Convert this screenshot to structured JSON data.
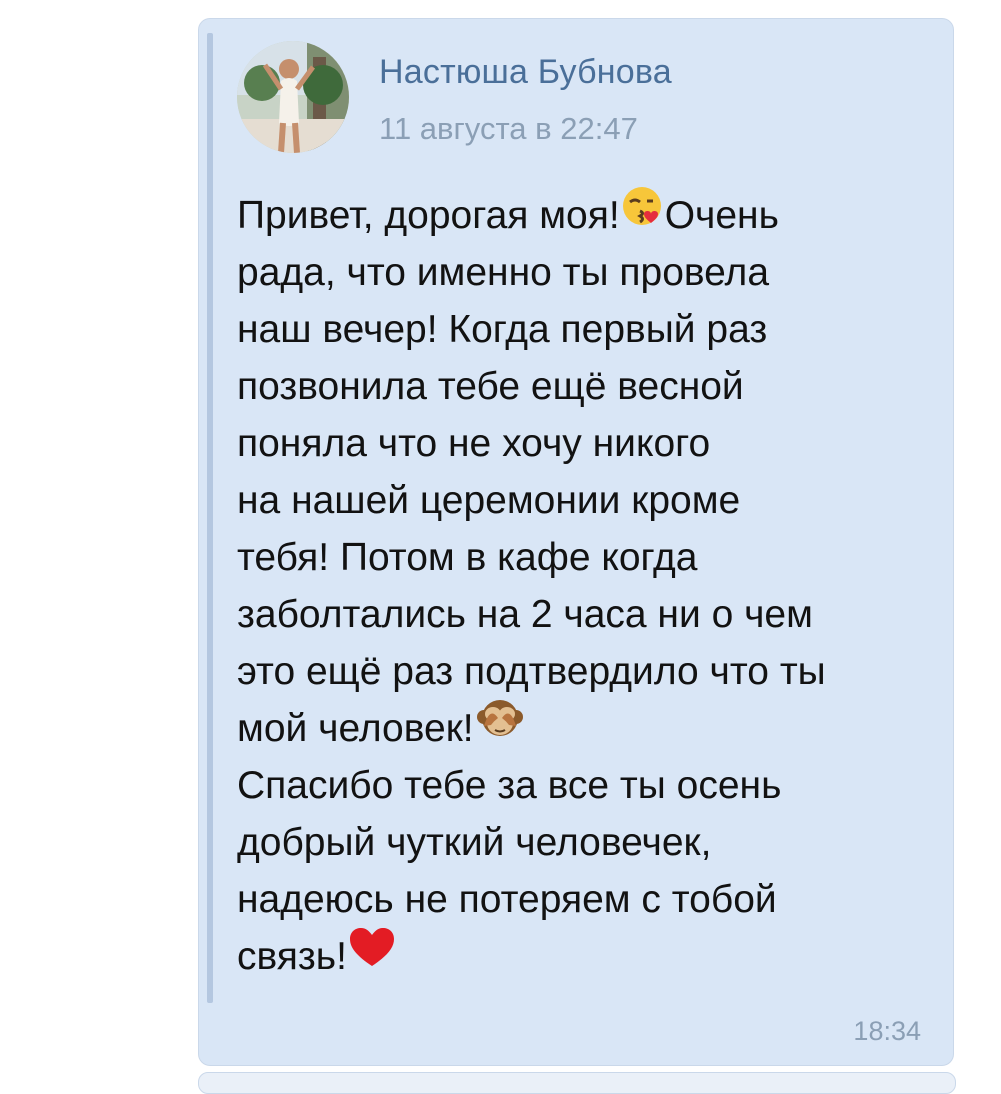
{
  "message": {
    "author": "Настюша Бубнова",
    "date": "11 августа в 22:47",
    "time": "18:34",
    "lines": [
      "Привет, дорогая моя!",
      "Очень",
      "рада, что именно ты провела",
      "наш вечер! Когда первый раз",
      "позвонила тебе ещё весной",
      "поняла что не хочу никого",
      "на нашей церемонии кроме",
      "тебя! Потом в кафе когда",
      "заболтались на 2 часа ни о чем",
      "это ещё раз подтвердило что ты",
      "мой человек!",
      "Спасибо тебе за все ты осень",
      "добрый чуткий человечек,",
      "надеюсь не потеряем с тобой",
      "связь!"
    ],
    "emojis": [
      "kiss-emoji",
      "see-no-evil-monkey-emoji",
      "red-heart-emoji"
    ]
  }
}
